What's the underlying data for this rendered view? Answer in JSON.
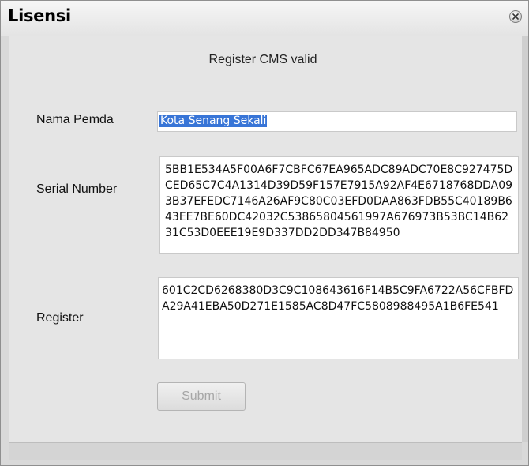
{
  "dialog": {
    "title": "Lisensi",
    "close_icon": "close-icon"
  },
  "status_message": "Register CMS valid",
  "form": {
    "nama_pemda": {
      "label": "Nama Pemda",
      "value": "Kota Senang Sekali"
    },
    "serial_number": {
      "label": "Serial Number",
      "value": "5BB1E534A5F00A6F7CBFC67EA965ADC89ADC70E8C927475DCED65C7C4A1314D39D59F157E7915A92AF4E6718768DDA093B37EFEDC7146A26AF9C80C03EFD0DAA863FDB55C40189B643EE7BE60DC42032C53865804561997A676973B53BC14B6231C53D0EEE19E9D337DD2DD347B84950"
    },
    "register": {
      "label": "Register",
      "value": "601C2CD6268380D3C9C108643616F14B5C9FA6722A56CFBFDA29A41EBA50D271E1585AC8D47FC5808988495A1B6FE541"
    },
    "submit_label": "Submit"
  },
  "colors": {
    "selection": "#3875d7",
    "panel": "#e5e5e5",
    "disabled_text": "#a6a6a6"
  }
}
